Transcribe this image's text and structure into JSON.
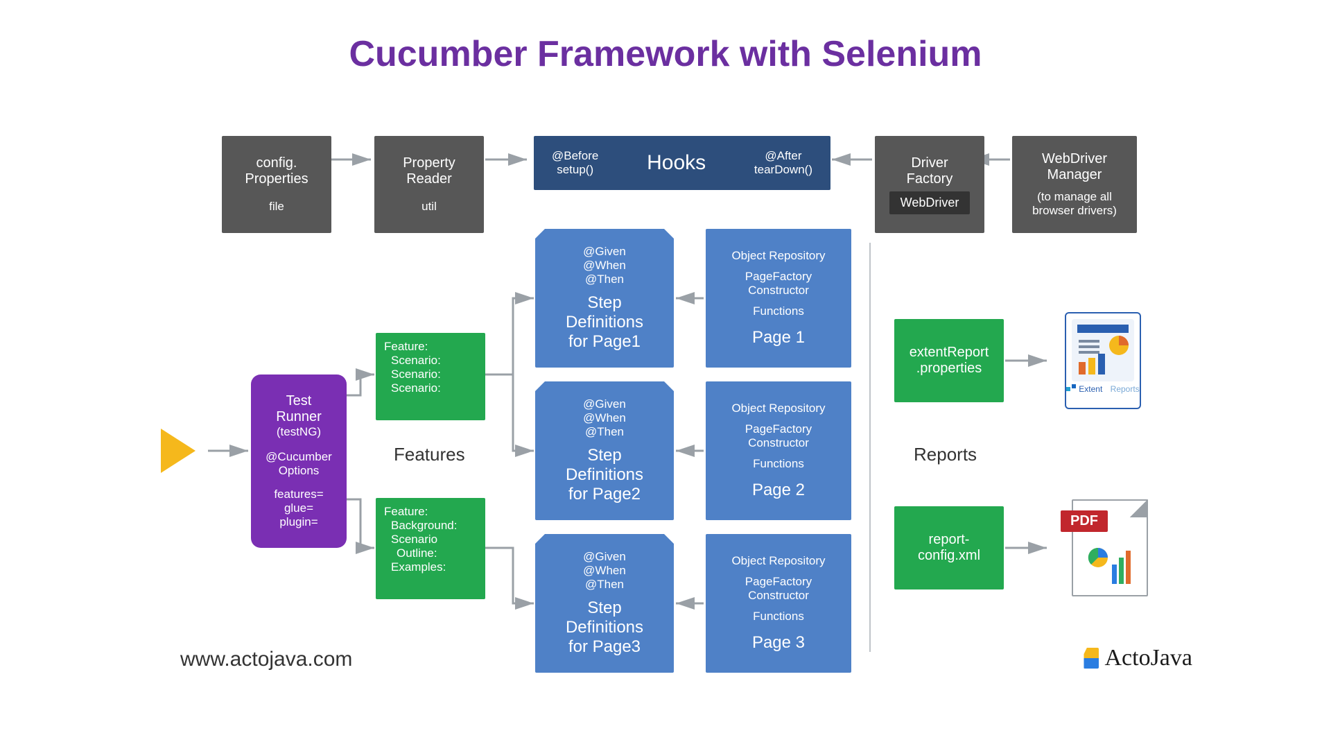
{
  "title": "Cucumber Framework with Selenium",
  "topRow": {
    "config": {
      "l1": "config.",
      "l2": "Properties",
      "sub": "file"
    },
    "reader": {
      "l1": "Property",
      "l2": "Reader",
      "sub": "util"
    },
    "hooks": {
      "before1": "@Before",
      "before2": "setup()",
      "center": "Hooks",
      "after1": "@After",
      "after2": "tearDown()"
    },
    "driver": {
      "l1": "Driver",
      "l2": "Factory",
      "chip": "WebDriver"
    },
    "wdm": {
      "l1": "WebDriver",
      "l2": "Manager",
      "sub": "(to manage all browser drivers)"
    }
  },
  "runner": {
    "l1": "Test",
    "l2": "Runner",
    "l3": "(testNG)",
    "l4": "@Cucumber",
    "l5": "Options",
    "l6": "features=",
    "l7": "glue=",
    "l8": "plugin="
  },
  "features": {
    "label": "Features",
    "f1": {
      "a": "Feature:",
      "b": "Scenario:",
      "c": "Scenario:",
      "d": "Scenario:"
    },
    "f2": {
      "a": "Feature:",
      "b": "Background:",
      "c": "Scenario",
      "d": "Outline:",
      "e": "Examples:"
    }
  },
  "steps": {
    "given": "@Given",
    "when": "@When",
    "then": "@Then",
    "s1a": "Step",
    "s1b": "Definitions",
    "s1c": "for Page1",
    "s2a": "Step",
    "s2b": "Definitions",
    "s2c": "for Page2",
    "s3a": "Step",
    "s3b": "Definitions",
    "s3c": "for Page3"
  },
  "pages": {
    "h1": "Object Repository",
    "h2": "PageFactory",
    "h3": "Constructor",
    "h4": "Functions",
    "p1": "Page 1",
    "p2": "Page 2",
    "p3": "Page 3"
  },
  "reports": {
    "label": "Reports",
    "r1a": "extentReport",
    "r1b": ".properties",
    "r2a": "report-",
    "r2b": "config.xml",
    "extentCaption1": "Extent",
    "extentCaption2": "Reports",
    "pdf": "PDF"
  },
  "footer": {
    "url": "www.actojava.com",
    "brand": "ActoJava"
  }
}
